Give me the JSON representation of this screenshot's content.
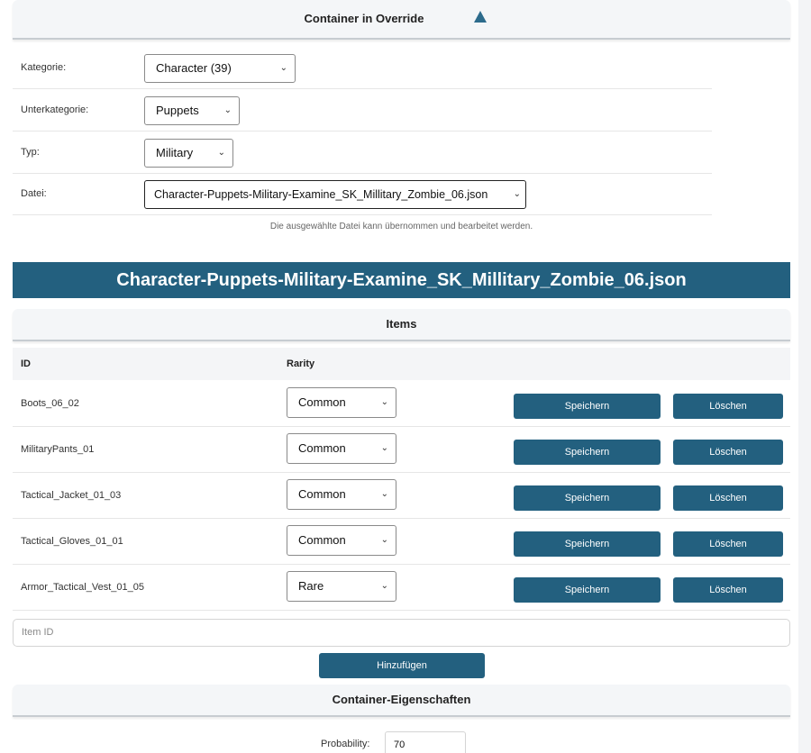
{
  "container_section": {
    "title": "Container in Override",
    "toggle_icon": "triangle-up-icon"
  },
  "filters": {
    "category_label": "Kategorie:",
    "category_value": "Character (39)",
    "subcategory_label": "Unterkategorie:",
    "subcategory_value": "Puppets",
    "type_label": "Typ:",
    "type_value": "Military",
    "file_label": "Datei:",
    "file_value": "Character-Puppets-Military-Examine_SK_Millitary_Zombie_06.json",
    "hint": "Die ausgewählte Datei kann übernommen und bearbeitet werden."
  },
  "file_banner": "Character-Puppets-Military-Examine_SK_Millitary_Zombie_06.json",
  "items_section": {
    "title": "Items",
    "col_id": "ID",
    "col_rarity": "Rarity",
    "save_label": "Speichern",
    "delete_label": "Löschen",
    "rows": [
      {
        "id": "Boots_06_02",
        "rarity": "Common"
      },
      {
        "id": "MilitaryPants_01",
        "rarity": "Common"
      },
      {
        "id": "Tactical_Jacket_01_03",
        "rarity": "Common"
      },
      {
        "id": "Tactical_Gloves_01_01",
        "rarity": "Common"
      },
      {
        "id": "Armor_Tactical_Vest_01_05",
        "rarity": "Rare"
      }
    ],
    "new_item_placeholder": "Item ID",
    "add_label": "Hinzufügen"
  },
  "properties_section": {
    "title": "Container-Eigenschaften",
    "probability_label": "Probability:",
    "probability_value": "70"
  },
  "colors": {
    "accent": "#23607f",
    "toggle": "#2c6b8c"
  }
}
